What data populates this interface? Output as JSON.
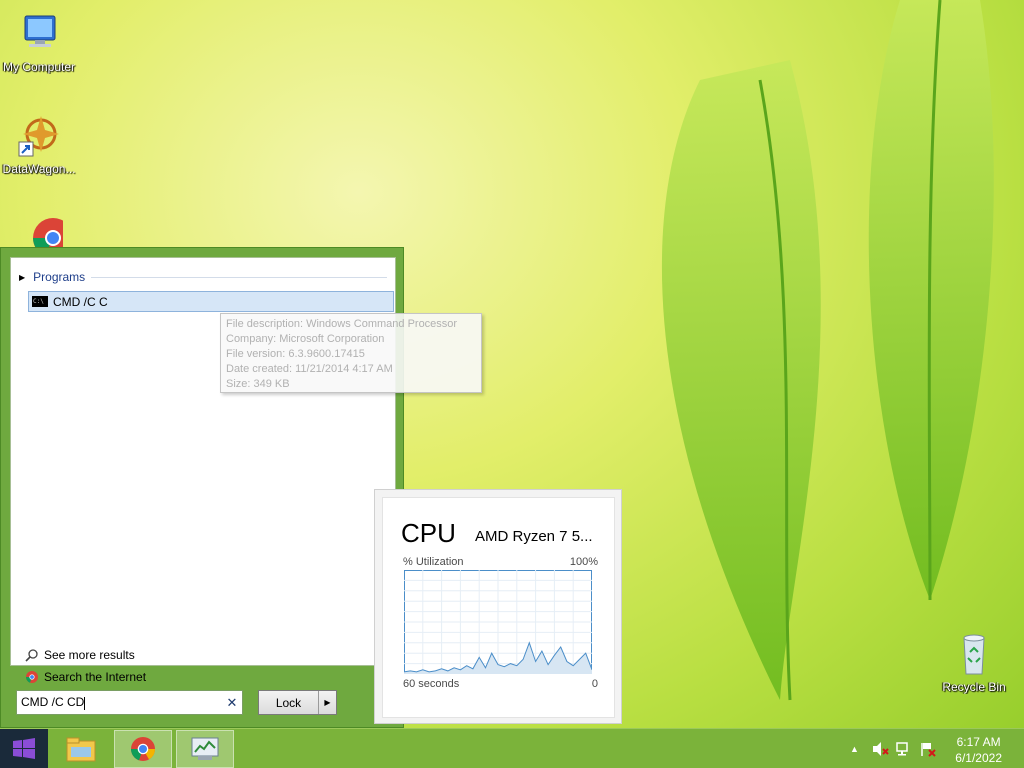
{
  "desktop": {
    "icons": [
      {
        "label": "My Computer"
      },
      {
        "label": "DataWagon..."
      },
      {
        "label": ""
      }
    ],
    "recycle_bin": {
      "label": "Recycle Bin"
    }
  },
  "start_menu": {
    "section_label": "Programs",
    "result": {
      "label": "CMD /C C"
    },
    "tooltip": {
      "description": "File description: Windows Command Processor",
      "company": "Company: Microsoft Corporation",
      "version": "File version: 6.3.9600.17415",
      "created": "Date created: 11/21/2014 4:17 AM",
      "size": "Size: 349 KB"
    },
    "see_more": "See more results",
    "search_internet": "Search the Internet",
    "search": {
      "value": "CMD /C CD"
    },
    "power_button": {
      "label": "Lock"
    }
  },
  "cpu_widget": {
    "title": "CPU",
    "model": "AMD Ryzen 7 5...",
    "util_label": "% Utilization",
    "max_label": "100%",
    "time_label": "60 seconds",
    "zero_label": "0",
    "line_color": "#4b8ec9",
    "fill_color": "#d7e6f3",
    "chart_data": {
      "type": "area",
      "x": [
        0,
        2,
        4,
        6,
        8,
        10,
        12,
        14,
        16,
        18,
        20,
        22,
        24,
        26,
        28,
        30,
        32,
        34,
        36,
        38,
        40,
        42,
        44,
        46,
        48,
        50,
        52,
        54,
        56,
        58,
        60
      ],
      "values": [
        2,
        3,
        2,
        4,
        2,
        3,
        5,
        3,
        6,
        4,
        8,
        5,
        16,
        6,
        20,
        9,
        7,
        10,
        8,
        14,
        30,
        12,
        22,
        9,
        18,
        26,
        12,
        8,
        14,
        20,
        4
      ],
      "xlabel": "60 seconds",
      "ylabel": "% Utilization",
      "ylim": [
        0,
        100
      ],
      "grid": true
    }
  },
  "taskbar": {
    "clock_time": "6:17 AM",
    "clock_date": "6/1/2022"
  }
}
